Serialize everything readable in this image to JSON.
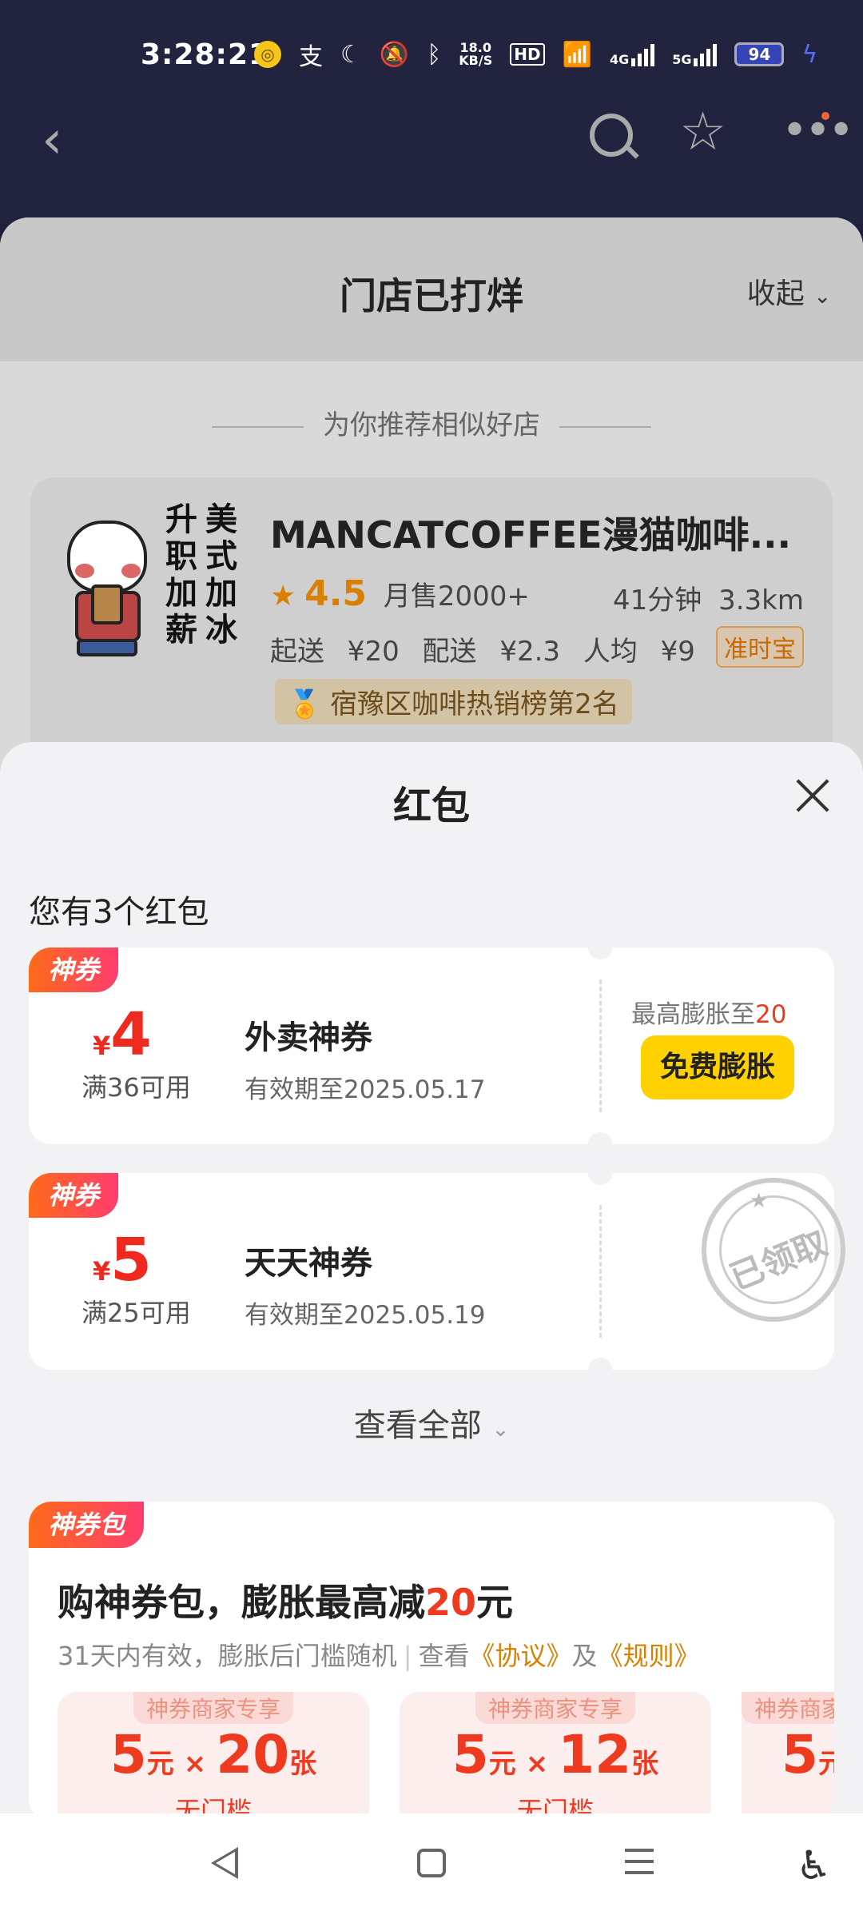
{
  "status_bar": {
    "time": "3:28:21",
    "net_speed_value": "18.0",
    "net_speed_unit": "KB/S",
    "hd": "HD",
    "net_4g": "4G",
    "net_5g": "5G",
    "battery": "94"
  },
  "sheet": {
    "title": "门店已打烊",
    "collapse_label": "收起",
    "recommend_label": "为你推荐相似好店"
  },
  "store": {
    "logo_text": [
      "升",
      "职",
      "加",
      "薪",
      "美",
      "式",
      "加",
      "冰"
    ],
    "name": "MANCATCOFFEE漫猫咖啡...",
    "rating": "4.5",
    "monthly_sales": "月售2000+",
    "delivery_time": "41分钟",
    "distance": "3.3km",
    "min_order": "起送 ¥20",
    "delivery_fee": "配送 ¥2.3",
    "avg_price": "人均 ¥9",
    "tag": "准时宝",
    "rank": "宿豫区咖啡热销榜第2名"
  },
  "red_packets": {
    "title": "红包",
    "count_label": "您有3个红包",
    "coupons": [
      {
        "badge": "神券",
        "currency": "¥",
        "amount": "4",
        "threshold": "满36可用",
        "name": "外卖神券",
        "expiry": "有效期至2025.05.17",
        "max_label": "最高膨胀至",
        "max_value": "20",
        "button": "免费膨胀"
      },
      {
        "badge": "神券",
        "currency": "¥",
        "amount": "5",
        "threshold": "满25可用",
        "name": "天天神券",
        "expiry": "有效期至2025.05.19",
        "stamp": "已领取"
      }
    ],
    "view_all": "查看全部"
  },
  "pack": {
    "badge": "神券包",
    "title_prefix": "购神券包，膨胀最高减",
    "title_value": "20",
    "title_suffix": "元",
    "sub_text": "31天内有效，膨胀后门槛随机",
    "sub_view": "查看",
    "sub_link1": "《协议》",
    "sub_and": "及",
    "sub_link2": "《规则》",
    "items": [
      {
        "tag": "神券商家专享",
        "value": "5",
        "unit": "元",
        "times": "×",
        "count": "20",
        "count_unit": "张",
        "note": "无门槛"
      },
      {
        "tag": "神券商家专享",
        "value": "5",
        "unit": "元",
        "times": "×",
        "count": "12",
        "count_unit": "张",
        "note": "无门槛"
      },
      {
        "tag": "神券商家专享",
        "value": "5",
        "unit": "元",
        "times": "×",
        "count": "",
        "count_unit": "",
        "note": ""
      }
    ]
  }
}
